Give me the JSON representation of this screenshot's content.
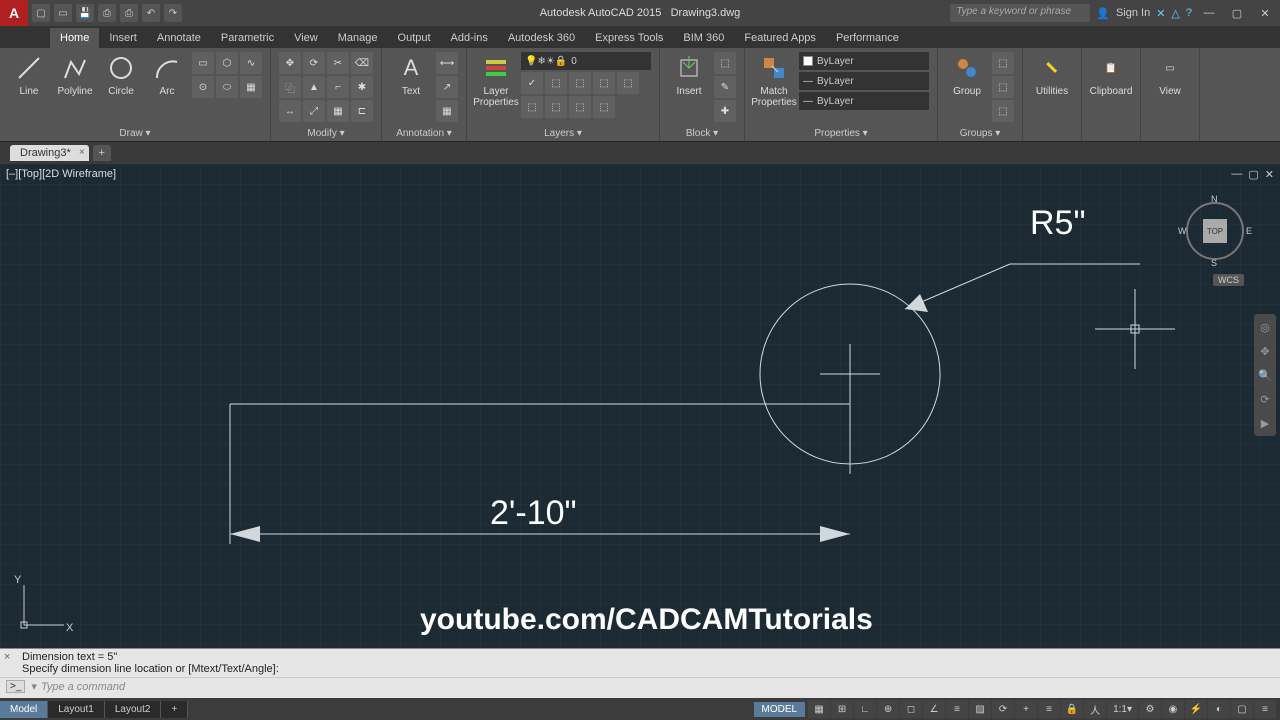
{
  "app": {
    "title": "Autodesk AutoCAD 2015",
    "file": "Drawing3.dwg"
  },
  "titlebar": {
    "search_placeholder": "Type a keyword or phrase",
    "signin": "Sign In"
  },
  "ribbon_tabs": [
    "Home",
    "Insert",
    "Annotate",
    "Parametric",
    "View",
    "Manage",
    "Output",
    "Add-ins",
    "Autodesk 360",
    "Express Tools",
    "BIM 360",
    "Featured Apps",
    "Performance"
  ],
  "ribbon": {
    "draw": {
      "label": "Draw ▾",
      "line": "Line",
      "polyline": "Polyline",
      "circle": "Circle",
      "arc": "Arc"
    },
    "modify": {
      "label": "Modify ▾"
    },
    "annotation": {
      "label": "Annotation ▾",
      "text": "Text"
    },
    "layers": {
      "label": "Layers ▾",
      "props": "Layer\nProperties",
      "current": "0"
    },
    "block": {
      "label": "Block ▾",
      "insert": "Insert"
    },
    "properties": {
      "label": "Properties ▾",
      "match": "Match\nProperties",
      "bylayer": "ByLayer"
    },
    "groups": {
      "label": "Groups ▾",
      "group": "Group"
    },
    "utilities": {
      "label": "Utilities"
    },
    "clipboard": {
      "label": "Clipboard"
    },
    "view": {
      "label": "View"
    }
  },
  "filetab": {
    "name": "Drawing3*"
  },
  "viewport": {
    "label": "[–][Top][2D Wireframe]"
  },
  "navcube": {
    "face": "TOP",
    "n": "N",
    "s": "S",
    "e": "E",
    "w": "W",
    "wcs": "WCS"
  },
  "drawing": {
    "dimension_linear": "2'-10\"",
    "dimension_radius": "R5\"",
    "watermark": "youtube.com/CADCAMTutorials"
  },
  "ucs": {
    "x": "X",
    "y": "Y"
  },
  "cmd": {
    "line1": "Dimension text = 5\"",
    "line2": "Specify dimension line location or [Mtext/Text/Angle]:",
    "placeholder": "Type a command"
  },
  "status": {
    "tabs": [
      "Model",
      "Layout1",
      "Layout2"
    ],
    "model": "MODEL",
    "scale": "1:1"
  }
}
